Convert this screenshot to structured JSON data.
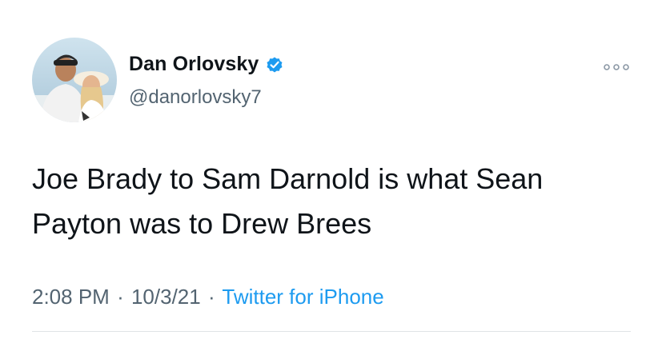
{
  "author": {
    "display_name": "Dan Orlovsky",
    "handle": "@danorlovsky7",
    "verified_icon": "verified-badge-icon",
    "avatar_icon": "profile-photo"
  },
  "menu": {
    "icon": "more-options-icon"
  },
  "tweet": {
    "text": "Joe Brady to Sam Darnold is what Sean Payton was to Drew Brees"
  },
  "meta": {
    "time": "2:08 PM",
    "separator": "·",
    "date": "10/3/21",
    "source": "Twitter for iPhone"
  },
  "colors": {
    "text": "#0f1419",
    "secondary": "#536471",
    "accent": "#1d9bf0",
    "divider": "#dfe3e6"
  }
}
